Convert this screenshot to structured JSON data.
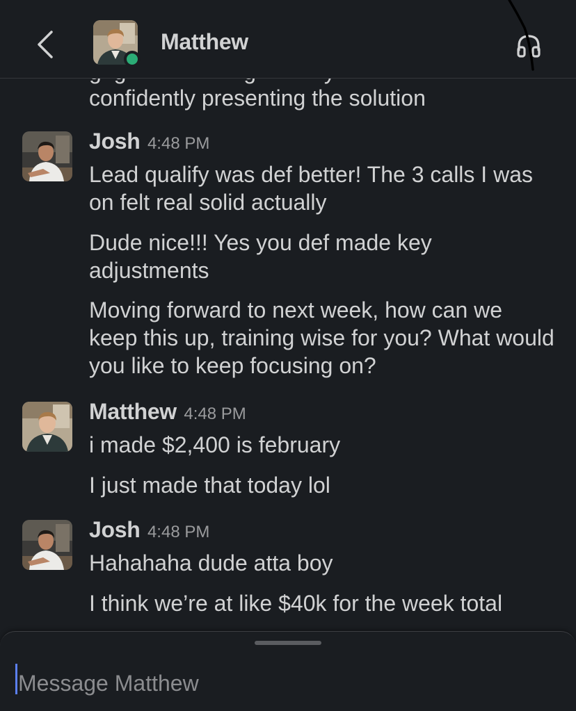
{
  "header": {
    "back_icon": "chevron-left-icon",
    "title": "Matthew",
    "presence": "online",
    "presence_color": "#2bac76",
    "call_icon": "headphones-icon"
  },
  "conversation": {
    "partial_previous_line": "confidently presenting the solution",
    "groups": [
      {
        "sender": "Josh",
        "time": "4:48 PM",
        "messages": [
          "Lead qualify was def better! The 3 calls I was on felt real solid actually",
          "Dude nice!!! Yes you def made key adjustments",
          "Moving forward to next week, how can we keep this up, training wise for you? What would you like to keep focusing on?"
        ]
      },
      {
        "sender": "Matthew",
        "time": "4:48 PM",
        "messages": [
          "i made $2,400 is february",
          "I just made that today lol"
        ]
      },
      {
        "sender": "Josh",
        "time": "4:48 PM",
        "messages": [
          "Hahahaha dude atta boy",
          "I think we’re at like $40k for the week total"
        ]
      }
    ]
  },
  "composer": {
    "placeholder": "Message Matthew",
    "caret_color": "#5b7ff0"
  }
}
